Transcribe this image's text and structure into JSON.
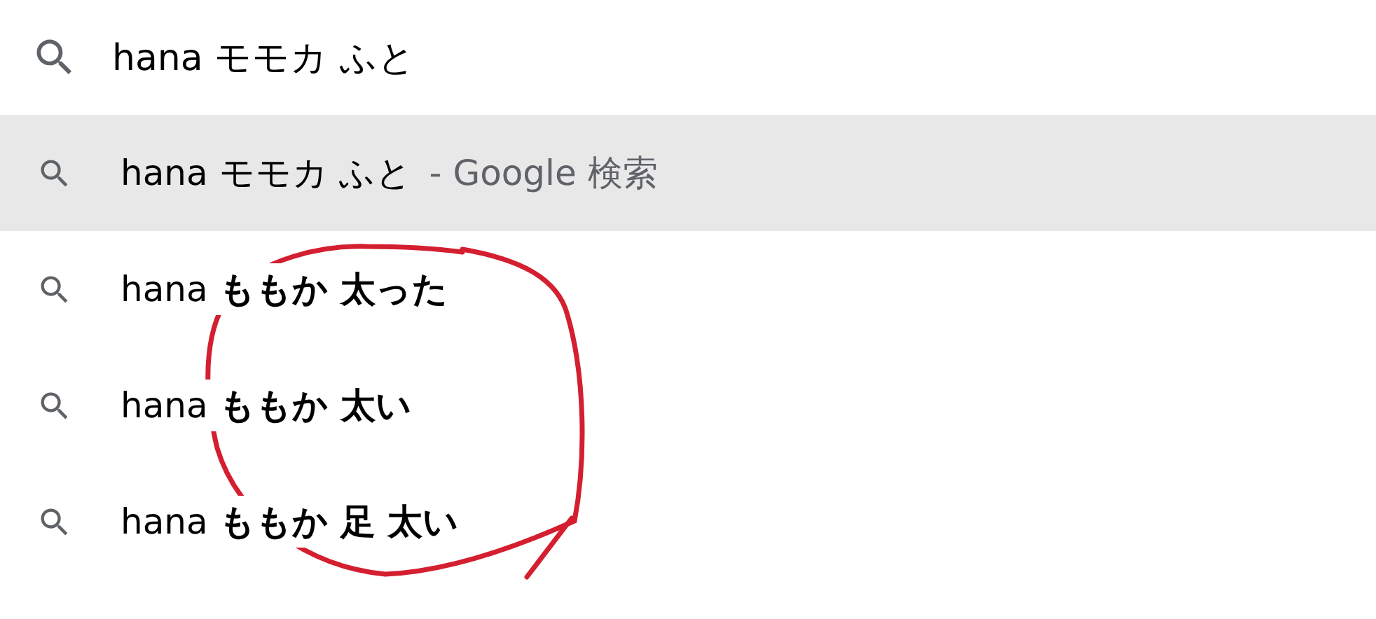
{
  "search": {
    "value": "hana モモカ ふと"
  },
  "suggestions": [
    {
      "text": "hana モモカ ふと",
      "suffix": "- Google 検索",
      "selected": true
    },
    {
      "text": "hana **ももか 太った**",
      "selected": false
    },
    {
      "text": "hana **ももか 太い**",
      "selected": false
    },
    {
      "text": "hana **ももか 足 太い**",
      "selected": false
    }
  ]
}
